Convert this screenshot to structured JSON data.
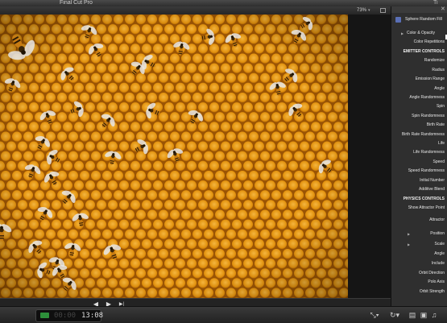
{
  "window": {
    "title": "Final Cut Pro",
    "right_title": "Ti"
  },
  "viewer": {
    "zoom": "73%"
  },
  "transport": {
    "prev": "◀",
    "play": "▶",
    "next": "▶|"
  },
  "inspector": {
    "generator_name": "Sphere Random Fill",
    "close_glyph": "✕",
    "params": [
      {
        "label": "Color & Opacity",
        "disclosure": true
      },
      {
        "label": "Color Repetitions"
      },
      {
        "label": "EMITTER CONTROLS",
        "section": true
      },
      {
        "label": "Randomize"
      },
      {
        "label": "Radius"
      },
      {
        "label": "Emission Range"
      },
      {
        "label": "Angle"
      },
      {
        "label": "Angle Randomness"
      },
      {
        "label": "Spin"
      },
      {
        "label": "Spin Randomness"
      },
      {
        "label": "Birth Rate"
      },
      {
        "label": "Birth Rate Randomness"
      },
      {
        "label": "Life"
      },
      {
        "label": "Life Randomness"
      },
      {
        "label": "Speed"
      },
      {
        "label": "Speed Randomness"
      },
      {
        "label": "Initial Number"
      },
      {
        "label": "Additive Blend"
      },
      {
        "label": "PHYSICS CONTROLS",
        "section": true
      },
      {
        "label": "Show Attractor Point"
      },
      {
        "label": "Attractor"
      },
      {
        "label": "Position",
        "disclosure": true
      },
      {
        "label": "Scale",
        "disclosure": true
      },
      {
        "label": "Angle"
      },
      {
        "label": "Include"
      },
      {
        "label": "Orbit Direction"
      },
      {
        "label": "Polo Axis"
      },
      {
        "label": "Orbit Strength"
      }
    ]
  },
  "timecode": {
    "ghost": "00:00",
    "value": "13:08"
  },
  "colors": {
    "honey": "#e89a1a",
    "honey_dark": "#a85e06",
    "accent": "#5a6fb6"
  }
}
